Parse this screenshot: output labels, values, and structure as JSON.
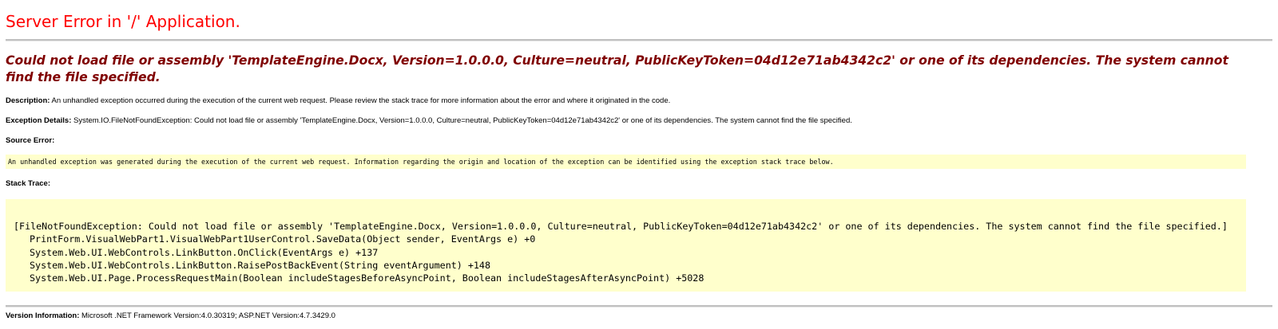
{
  "page": {
    "title": "Server Error in '/' Application.",
    "error_message": "Could not load file or assembly 'TemplateEngine.Docx, Version=1.0.0.0, Culture=neutral, PublicKeyToken=04d12e71ab4342c2' or one of its dependencies. The system cannot find the file specified.",
    "description": {
      "label": "Description:",
      "text": " An unhandled exception occurred during the execution of the current web request. Please review the stack trace for more information about the error and where it originated in the code."
    },
    "exception_details": {
      "label": "Exception Details:",
      "text": " System.IO.FileNotFoundException: Could not load file or assembly 'TemplateEngine.Docx, Version=1.0.0.0, Culture=neutral, PublicKeyToken=04d12e71ab4342c2' or one of its dependencies. The system cannot find the file specified."
    },
    "source_error": {
      "label": "Source Error:",
      "text": "An unhandled exception was generated during the execution of the current web request. Information regarding the origin and location of the exception can be identified using the exception stack trace below."
    },
    "stack_trace": {
      "label": "Stack Trace:",
      "exception_line": "[FileNotFoundException: Could not load file or assembly 'TemplateEngine.Docx, Version=1.0.0.0, Culture=neutral, PublicKeyToken=04d12e71ab4342c2' or one of its dependencies. The system cannot find the file specified.]",
      "frames": [
        "PrintForm.VisualWebPart1.VisualWebPart1UserControl.SaveData(Object sender, EventArgs e) +0",
        "System.Web.UI.WebControls.LinkButton.OnClick(EventArgs e) +137",
        "System.Web.UI.WebControls.LinkButton.RaisePostBackEvent(String eventArgument) +148",
        "System.Web.UI.Page.ProcessRequestMain(Boolean includeStagesBeforeAsyncPoint, Boolean includeStagesAfterAsyncPoint) +5028"
      ]
    },
    "version_information": {
      "label": "Version Information:",
      "text": " Microsoft .NET Framework Version:4.0.30319; ASP.NET Version:4.7.3429.0"
    },
    "colors": {
      "title": "#ff0000",
      "error_message": "#800000",
      "code_background": "#ffffcc",
      "rule": "#c0c0c0"
    }
  }
}
